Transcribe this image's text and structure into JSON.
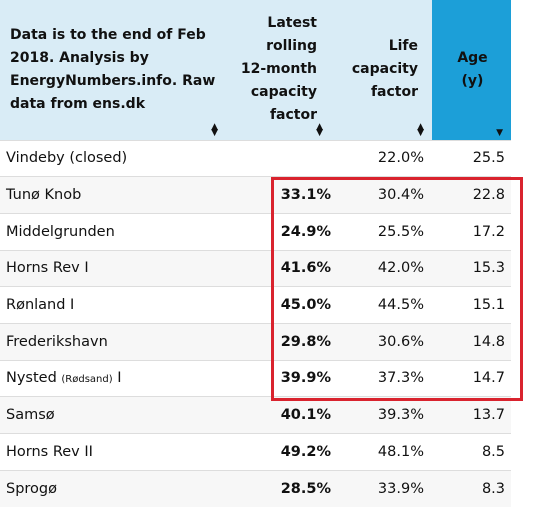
{
  "header": {
    "name_col": "Data is to the end of Feb 2018. Analysis by EnergyNumbers.info. Raw data from ens.dk",
    "latest_col": "Latest rolling 12-month capacity factor",
    "life_col": "Life capacity factor",
    "age_col": "Age (y)",
    "sorted_column": "age",
    "sort_direction": "descending"
  },
  "colors": {
    "header_bg": "#d9ecf6",
    "sorted_header_bg": "#1c9fd8",
    "highlight_box": "#d9232e"
  },
  "rows": [
    {
      "name": "Vindeby (closed)",
      "latest": "",
      "life": "22.0%",
      "age": "25.5"
    },
    {
      "name": "Tunø Knob",
      "latest": "33.1%",
      "life": "30.4%",
      "age": "22.8"
    },
    {
      "name": "Middelgrunden",
      "latest": "24.9%",
      "life": "25.5%",
      "age": "17.2"
    },
    {
      "name": "Horns Rev I",
      "latest": "41.6%",
      "life": "42.0%",
      "age": "15.3"
    },
    {
      "name": "Rønland I",
      "latest": "45.0%",
      "life": "44.5%",
      "age": "15.1"
    },
    {
      "name": "Frederikshavn",
      "latest": "29.8%",
      "life": "30.6%",
      "age": "14.8"
    },
    {
      "name": "Nysted",
      "name_sub": "(Rødsand)",
      "name_suffix": " I",
      "latest": "39.9%",
      "life": "37.3%",
      "age": "14.7"
    },
    {
      "name": "Samsø",
      "latest": "40.1%",
      "life": "39.3%",
      "age": "13.7"
    },
    {
      "name": "Horns Rev II",
      "latest": "49.2%",
      "life": "48.1%",
      "age": "8.5"
    },
    {
      "name": "Sprogø",
      "latest": "28.5%",
      "life": "33.9%",
      "age": "8.3"
    }
  ]
}
